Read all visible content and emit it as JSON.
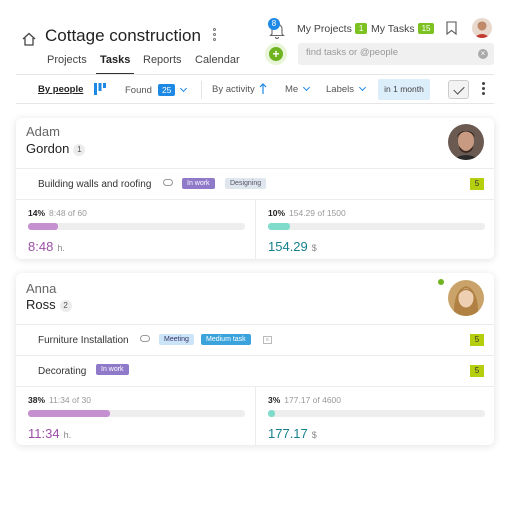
{
  "header": {
    "title": "Cottage construction",
    "tabs": [
      "Projects",
      "Tasks",
      "Reports",
      "Calendar"
    ],
    "active_tab": "Tasks",
    "notifications_count": "8",
    "my_projects_label": "My Projects",
    "my_projects_count": "1",
    "my_tasks_label": "My Tasks",
    "my_tasks_count": "15",
    "search_placeholder": "find tasks or @people"
  },
  "filterbar": {
    "by_people": "By people",
    "found_label": "Found",
    "found_count": "25",
    "by_activity": "By activity",
    "me": "Me",
    "labels": "Labels",
    "period": "in 1 month"
  },
  "people": [
    {
      "first": "Adam",
      "last": "Gordon",
      "task_count": "1",
      "online": false,
      "tasks": [
        {
          "name": "Building walls and roofing",
          "tags": [
            "In work",
            "Designing"
          ],
          "count": "5"
        }
      ],
      "time": {
        "pct": "14%",
        "of": "8:48 of 60",
        "value": "8:48",
        "unit": "h.",
        "fraction": 0.14
      },
      "money": {
        "pct": "10%",
        "of": "154.29 of 1500",
        "value": "154.29",
        "unit": "$",
        "fraction": 0.1
      }
    },
    {
      "first": "Anna",
      "last": "Ross",
      "task_count": "2",
      "online": true,
      "tasks": [
        {
          "name": "Furniture Installation",
          "tags": [
            "Meeting",
            "Medium task"
          ],
          "count": "5"
        },
        {
          "name": "Decorating",
          "tags": [
            "In work"
          ],
          "count": "5"
        }
      ],
      "time": {
        "pct": "38%",
        "of": "11:34 of 30",
        "value": "11:34",
        "unit": "h.",
        "fraction": 0.38
      },
      "money": {
        "pct": "3%",
        "of": "177.17 of 4600",
        "value": "177.17",
        "unit": "$",
        "fraction": 0.03
      }
    }
  ],
  "colors": {
    "time_fill": "#c590cf",
    "time_text": "#9c4fa6",
    "money_fill": "#7fdccb",
    "money_text": "#17808f",
    "accent_blue": "#1e88e5",
    "green": "#7cc221"
  }
}
